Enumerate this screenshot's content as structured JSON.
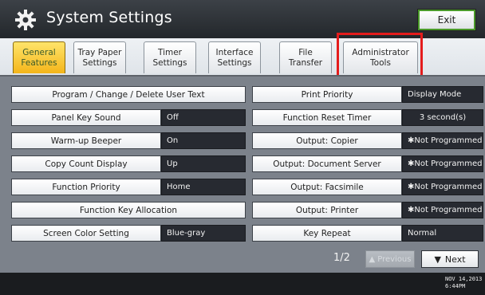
{
  "window": {
    "title": "System Settings",
    "exit_label": "Exit"
  },
  "tabs": [
    {
      "line1": "General",
      "line2": "Features",
      "active": true
    },
    {
      "line1": "Tray Paper",
      "line2": "Settings",
      "active": false
    },
    {
      "line1": "Timer",
      "line2": "Settings",
      "active": false
    },
    {
      "line1": "Interface",
      "line2": "Settings",
      "active": false
    },
    {
      "line1": "File",
      "line2": "Transfer",
      "active": false
    },
    {
      "line1": "Administrator",
      "line2": "Tools",
      "active": false
    }
  ],
  "left_items": [
    {
      "label": "Program / Change / Delete User Text",
      "value": ""
    },
    {
      "label": "Panel Key Sound",
      "value": "Off"
    },
    {
      "label": "Warm-up Beeper",
      "value": "On"
    },
    {
      "label": "Copy Count Display",
      "value": "Up"
    },
    {
      "label": "Function Priority",
      "value": "Home"
    },
    {
      "label": "Function Key Allocation",
      "value": ""
    },
    {
      "label": "Screen Color Setting",
      "value": "Blue-gray"
    }
  ],
  "right_items": [
    {
      "label": "Print Priority",
      "value": "Display Mode"
    },
    {
      "label": "Function Reset Timer",
      "value": "3 second(s)"
    },
    {
      "label": "Output: Copier",
      "value": "✱Not Programmed"
    },
    {
      "label": "Output: Document Server",
      "value": "✱Not Programmed"
    },
    {
      "label": "Output: Facsimile",
      "value": "✱Not Programmed"
    },
    {
      "label": "Output: Printer",
      "value": "✱Not Programmed"
    },
    {
      "label": "Key Repeat",
      "value": "Normal"
    }
  ],
  "pagination": {
    "indicator": "1/2",
    "previous_label": "Previous",
    "next_label": "Next"
  },
  "status": {
    "date": "NOV 14,2013",
    "time": "6:44PM"
  },
  "colors": {
    "active_tab": "#f4b51a",
    "highlight": "#e41c1c",
    "value_bg": "#272a31",
    "panel": "#7c828b"
  }
}
